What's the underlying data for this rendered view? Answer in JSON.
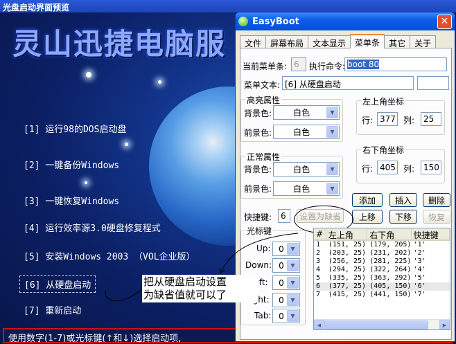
{
  "preview": {
    "title": "光盘启动界面预览",
    "banner": "灵山迅捷电脑服",
    "menu": [
      "[1] 运行98的DOS启动盘",
      "[2] 一键备份Windows",
      "[3] 一键恢复Windows",
      "[4] 运行效率源3.0硬盘修复程式",
      "[5] 安装Windows 2003 （VOL企业版）",
      "[6] 从硬盘启动",
      "[7] 重新启动"
    ],
    "status": "使用数字(1-7)或光标键(↑和↓)选择启动项,"
  },
  "annotation": {
    "line1": "把从硬盘启动设置",
    "line2": "为缺省值就可以了"
  },
  "window": {
    "title": "EasyBoot",
    "close": "✕",
    "tabs": [
      "文件",
      "屏幕布局",
      "文本显示",
      "菜单条",
      "其它",
      "关于"
    ],
    "current_item_label": "当前菜单条:",
    "current_item_value": "6",
    "exec_label": "执行命令:",
    "exec_value": "boot 80",
    "menu_text_label": "菜单文本:",
    "menu_text_value": "[6] 从硬盘启动",
    "highlight": {
      "title": "高亮属性",
      "bg_label": "背景色:",
      "bg_value": "白色",
      "fg_label": "前景色:",
      "fg_value": "白色"
    },
    "normal": {
      "title": "正常属性",
      "bg_label": "背景色:",
      "bg_value": "白色",
      "fg_label": "前景色:",
      "fg_value": "白色"
    },
    "top_left": {
      "title": "左上角坐标",
      "row_label": "行:",
      "row_value": "377",
      "col_label": "列:",
      "col_value": "25"
    },
    "bottom_right": {
      "title": "右下角坐标",
      "row_label": "行:",
      "row_value": "405",
      "col_label": "列:",
      "col_value": "150"
    },
    "buttons": {
      "add": "添加",
      "insert": "插入",
      "delete": "删除",
      "up": "上移",
      "down": "下移",
      "restore": "恢复",
      "set_default": "设置为缺省"
    },
    "shortcut_label": "快捷键:",
    "shortcut_value": "6",
    "cursor": {
      "title": "光标键",
      "up_label": "Up:",
      "up_value": "0",
      "down_label": "Down:",
      "down_value": "0",
      "left_label": "Left:",
      "left_value": "0",
      "right_label": "Right:",
      "right_value": "0",
      "tab_label": "Tab:",
      "tab_value": "0"
    },
    "list": {
      "headers": [
        "#",
        "左上角",
        "右下角",
        "快捷键"
      ],
      "rows": [
        [
          "1",
          "(151, 25)",
          "(179, 205)",
          "'1'"
        ],
        [
          "2",
          "(203, 25)",
          "(231, 202)",
          "'2'"
        ],
        [
          "3",
          "(256, 25)",
          "(281, 225)",
          "'3'"
        ],
        [
          "4",
          "(294, 25)",
          "(322, 264)",
          "'4'"
        ],
        [
          "5",
          "(335, 25)",
          "(363, 292)",
          "'5'"
        ],
        [
          "6",
          "(377, 25)",
          "(405, 150)",
          "'6'"
        ],
        [
          "7",
          "(415, 25)",
          "(441, 150)",
          "'7'"
        ]
      ],
      "selected_row": 5
    }
  }
}
